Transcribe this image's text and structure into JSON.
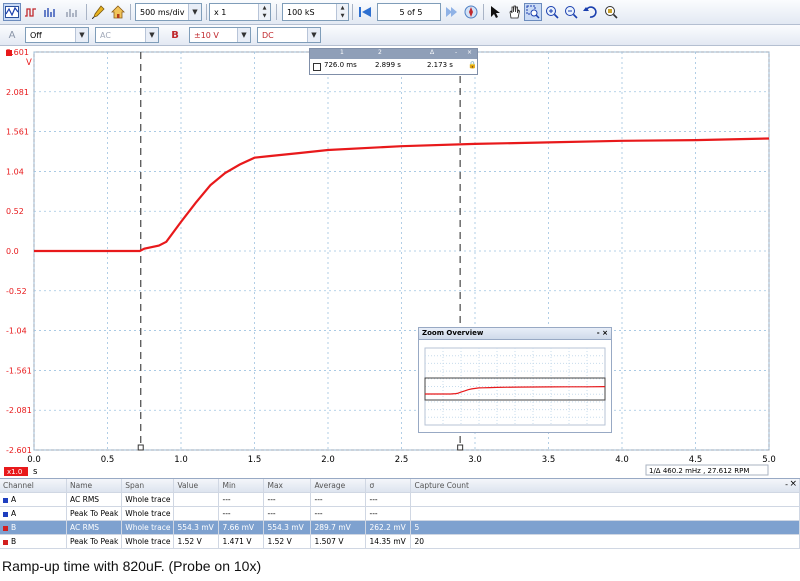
{
  "toolbar": {
    "timebase": "500 ms/div",
    "zoom": "x 1",
    "samples": "100 kS",
    "buffer": "5 of 5"
  },
  "channel_bar": {
    "channel_a_label": "A",
    "channel_a_coupling_state": "Off",
    "channel_a_coupling": "AC",
    "channel_b_label": "B",
    "channel_b_range": "±10 V",
    "channel_b_coupling": "DC"
  },
  "chart_data": {
    "type": "line",
    "ylabel_unit": "V",
    "xlabel_unit": "s",
    "ylim": [
      -2.601,
      2.601
    ],
    "xlim": [
      0.0,
      5.0
    ],
    "y_ticks": [
      "2.601",
      "2.081",
      "1.561",
      "1.04",
      "0.52",
      "0.0",
      "-0.52",
      "-1.04",
      "-1.561",
      "-2.081",
      "-2.601"
    ],
    "x_ticks": [
      "0.0",
      "0.5",
      "1.0",
      "1.5",
      "2.0",
      "2.5",
      "3.0",
      "3.5",
      "4.0",
      "4.5",
      "5.0"
    ],
    "series": [
      {
        "color": "#e8191b",
        "x": [
          0.0,
          0.5,
          0.72,
          0.75,
          0.85,
          0.9,
          1.0,
          1.1,
          1.2,
          1.3,
          1.4,
          1.5,
          1.6,
          1.8,
          2.0,
          2.5,
          3.0,
          3.5,
          4.0,
          4.5,
          5.0
        ],
        "y": [
          0.0,
          0.0,
          0.0,
          0.03,
          0.07,
          0.12,
          0.38,
          0.63,
          0.86,
          1.02,
          1.13,
          1.22,
          1.24,
          1.28,
          1.32,
          1.37,
          1.4,
          1.42,
          1.44,
          1.45,
          1.47
        ]
      }
    ],
    "rulers_x": [
      0.726,
      2.899
    ],
    "grid": true
  },
  "ruler_legend": {
    "col1": "1",
    "col2": "2",
    "col3": "Δ",
    "time1": "726.0 ms",
    "time2": "2.899 s",
    "delta": "2.173 s"
  },
  "zoom_overview": {
    "title": "Zoom Overview",
    "controls": "- ×"
  },
  "axis_extra": {
    "xscale_badge": "x1.0",
    "unit_s": "s",
    "unit_v": "V",
    "frequency_readout": "1/Δ 460.2 mHz , 27.612 RPM"
  },
  "measurements": {
    "headers": [
      "Channel",
      "Name",
      "Span",
      "Value",
      "Min",
      "Max",
      "Average",
      "σ",
      "Capture Count"
    ],
    "rows": [
      {
        "channel": "A",
        "name": "AC RMS",
        "span": "Whole trace",
        "value": "",
        "min": "---",
        "max": "---",
        "average": "---",
        "sigma": "---",
        "count": "",
        "color": "#1f3fbf",
        "selected": false
      },
      {
        "channel": "A",
        "name": "Peak To Peak",
        "span": "Whole trace",
        "value": "",
        "min": "---",
        "max": "---",
        "average": "---",
        "sigma": "---",
        "count": "",
        "color": "#1f3fbf",
        "selected": false
      },
      {
        "channel": "B",
        "name": "AC RMS",
        "span": "Whole trace",
        "value": "554.3 mV",
        "min": "7.66 mV",
        "max": "554.3 mV",
        "average": "289.7 mV",
        "sigma": "262.2 mV",
        "count": "5",
        "color": "#d21f1f",
        "selected": true
      },
      {
        "channel": "B",
        "name": "Peak To Peak",
        "span": "Whole trace",
        "value": "1.52 V",
        "min": "1.471 V",
        "max": "1.52 V",
        "average": "1.507 V",
        "sigma": "14.35 mV",
        "count": "20",
        "color": "#d21f1f",
        "selected": false
      }
    ]
  },
  "caption": "Ramp-up time with 820uF. (Probe on 10x)"
}
